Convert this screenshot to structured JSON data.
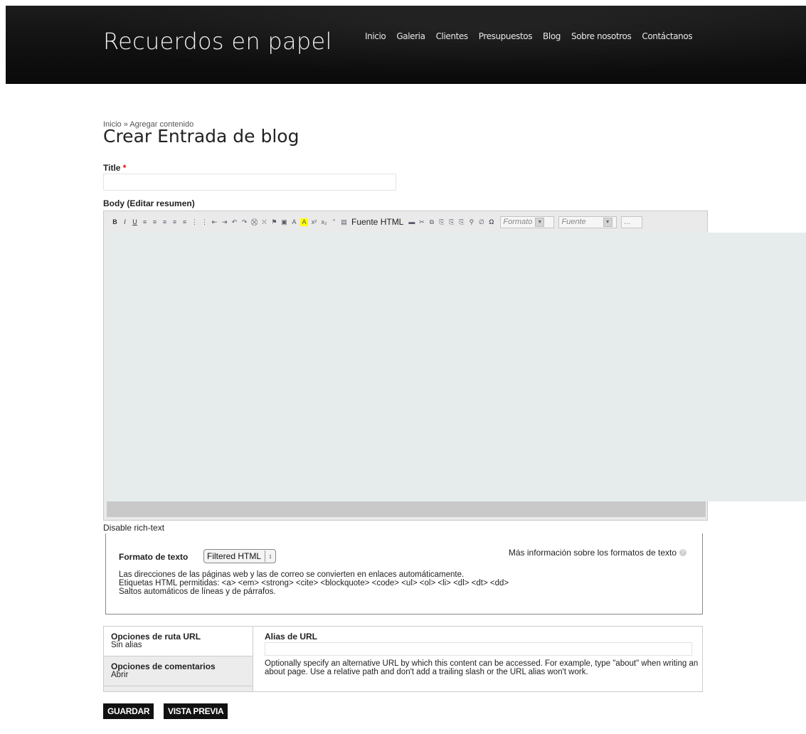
{
  "site": {
    "name": "Recuerdos en papel",
    "nav": [
      "Inicio",
      "Galeria",
      "Clientes",
      "Presupuestos",
      "Blog",
      "Sobre nosotros",
      "Contáctanos"
    ]
  },
  "breadcrumb": {
    "home": "Inicio",
    "separator": "»",
    "current": "Agregar contenido"
  },
  "page_title": "Crear Entrada de blog",
  "form": {
    "title_label": "Title",
    "required_mark": "*",
    "title_value": "",
    "body_label": "Body (Editar resumen)",
    "toolbar": {
      "bold": "B",
      "italic": "I",
      "underline": "U",
      "source_label": "Fuente HTML",
      "format_combo": "Formato",
      "font_combo": "Fuente",
      "more_combo": "..."
    },
    "disable_rich_text": "Disable rich-text",
    "text_format": {
      "label": "Formato de texto",
      "selected": "Filtered HTML",
      "more_info": "Más información sobre los formatos de texto",
      "tips": [
        "Las direcciones de las páginas web y las de correo se convierten en enlaces automáticamente.",
        "Etiquetas HTML permitidas: <a> <em> <strong> <cite> <blockquote> <code> <ul> <ol> <li> <dl> <dt> <dd>",
        "Saltos automáticos de líneas y de párrafos."
      ]
    },
    "vertical_tabs": [
      {
        "title": "Opciones de ruta URL",
        "summary": "Sin alias"
      },
      {
        "title": "Opciones de comentarios",
        "summary": "Abrir"
      }
    ],
    "url_alias": {
      "label": "Alias de URL",
      "value": "",
      "description": "Optionally specify an alternative URL by which this content can be accessed. For example, type \"about\" when writing an about page. Use a relative path and don't add a trailing slash or the URL alias won't work."
    },
    "buttons": {
      "save": "GUARDAR",
      "preview": "VISTA PREVIA"
    }
  }
}
